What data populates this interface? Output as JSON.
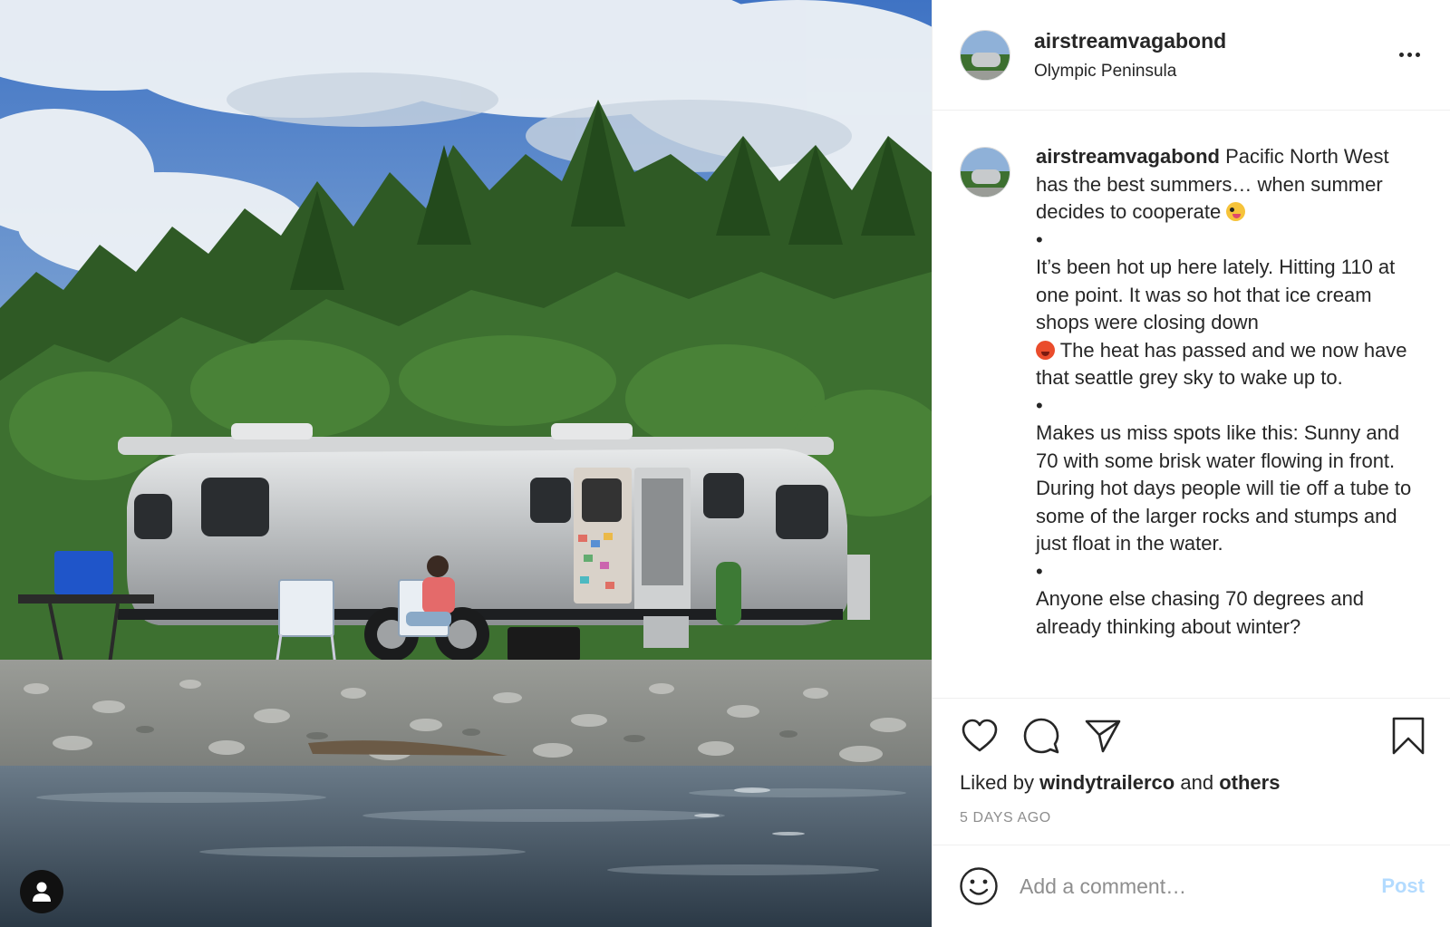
{
  "header": {
    "username": "airstreamvagabond",
    "location": "Olympic Peninsula"
  },
  "caption": {
    "username": "airstreamvagabond",
    "line1": "Pacific North West has the best summers… when summer decides to cooperate",
    "emoji1": "zany-face-emoji",
    "bullet": "•",
    "para2a": "It’s been hot up here lately. Hitting 110 at one point. It was so hot that ice cream shops were closing down",
    "emoji2": "hot-face-emoji",
    "para2b": "The heat has passed and we now have that seattle grey sky to wake up to.",
    "para3": "Makes us miss spots like this: Sunny and 70 with some brisk water flowing in front. During hot days people will tie off a tube to some of the larger rocks and stumps and just float in the water.",
    "para4": "Anyone else chasing 70 degrees and already thinking about winter?"
  },
  "likes": {
    "prefix": "Liked by",
    "user": "windytrailerco",
    "joiner": "and",
    "others": "others"
  },
  "timestamp": "5 DAYS AGO",
  "composer": {
    "placeholder": "Add a comment…",
    "post_label": "Post"
  },
  "icons": {
    "like": "heart-icon",
    "comment": "comment-icon",
    "share": "paper-plane-icon",
    "save": "bookmark-icon",
    "emoji": "smiley-icon",
    "tag": "user-icon",
    "more": "more-options-icon"
  },
  "colors": {
    "text": "#262626",
    "muted": "#8e8e8e",
    "post_disabled": "#b3dbff",
    "divider": "#efefef"
  }
}
